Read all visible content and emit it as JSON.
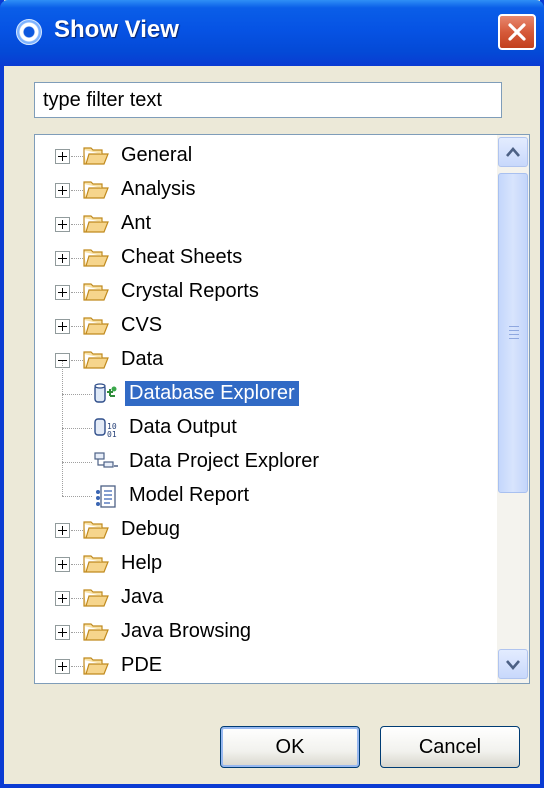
{
  "window": {
    "title": "Show View"
  },
  "filter": {
    "placeholder": "type filter text"
  },
  "tree": {
    "items": [
      {
        "label": "General",
        "type": "folder",
        "expanded": false
      },
      {
        "label": "Analysis",
        "type": "folder",
        "expanded": false
      },
      {
        "label": "Ant",
        "type": "folder",
        "expanded": false
      },
      {
        "label": "Cheat Sheets",
        "type": "folder",
        "expanded": false
      },
      {
        "label": "Crystal Reports",
        "type": "folder",
        "expanded": false
      },
      {
        "label": "CVS",
        "type": "folder",
        "expanded": false
      },
      {
        "label": "Data",
        "type": "folder",
        "expanded": true
      },
      {
        "label": "Database Explorer",
        "type": "view",
        "icon": "database-explorer-icon",
        "selected": true
      },
      {
        "label": "Data Output",
        "type": "view",
        "icon": "data-output-icon"
      },
      {
        "label": "Data Project Explorer",
        "type": "view",
        "icon": "data-project-explorer-icon"
      },
      {
        "label": "Model Report",
        "type": "view",
        "icon": "model-report-icon"
      },
      {
        "label": "Debug",
        "type": "folder",
        "expanded": false
      },
      {
        "label": "Help",
        "type": "folder",
        "expanded": false
      },
      {
        "label": "Java",
        "type": "folder",
        "expanded": false
      },
      {
        "label": "Java Browsing",
        "type": "folder",
        "expanded": false
      },
      {
        "label": "PDE",
        "type": "folder",
        "expanded": false
      }
    ]
  },
  "buttons": {
    "ok": "OK",
    "cancel": "Cancel"
  },
  "colors": {
    "selection": "#316ac5",
    "titlebar": "#0653e4",
    "dialog": "#ece9d8"
  }
}
